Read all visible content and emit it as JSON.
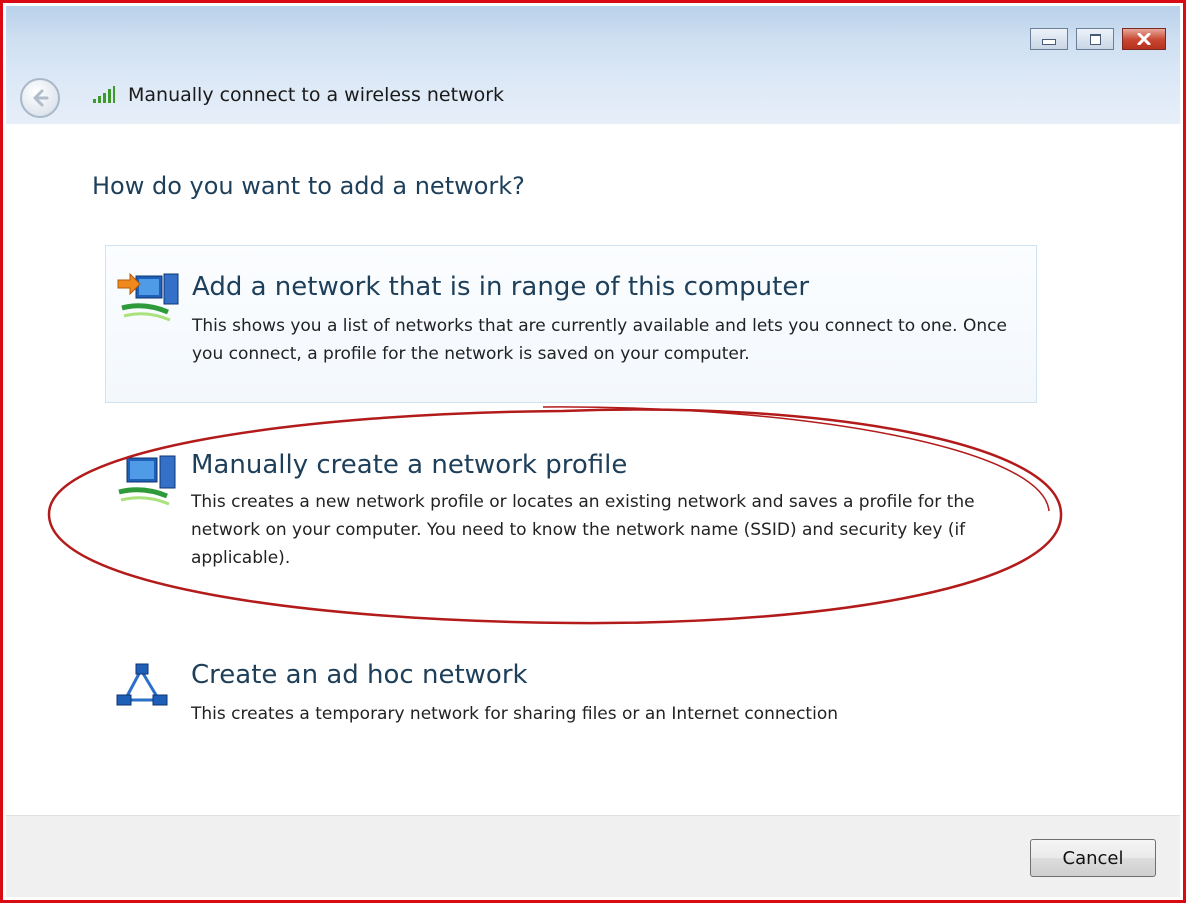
{
  "window": {
    "title": "Manually connect to a wireless network",
    "buttons": {
      "minimize": "minimize-icon",
      "maximize": "maximize-icon",
      "close": "close-icon"
    }
  },
  "heading": "How do you want to add a network?",
  "options": [
    {
      "title": "Add a network that is in range of this computer",
      "description": "This shows you a list of networks that are currently available and lets you connect to one. Once you connect, a profile for the network is saved on your computer.",
      "icon": "network-in-range-icon"
    },
    {
      "title": "Manually create a network profile",
      "description": "This creates a new network profile or locates an existing network and saves a profile for the network on your computer. You need to know the network name (SSID) and security key (if applicable).",
      "icon": "network-profile-icon"
    },
    {
      "title": "Create an ad hoc network",
      "description": "This creates a temporary network for sharing files or an Internet connection",
      "icon": "ad-hoc-network-icon"
    }
  ],
  "footer": {
    "cancel_label": "Cancel"
  },
  "colors": {
    "border": "#d90a14",
    "heading": "#1e3f5a",
    "annotation": "#b31b1b"
  }
}
